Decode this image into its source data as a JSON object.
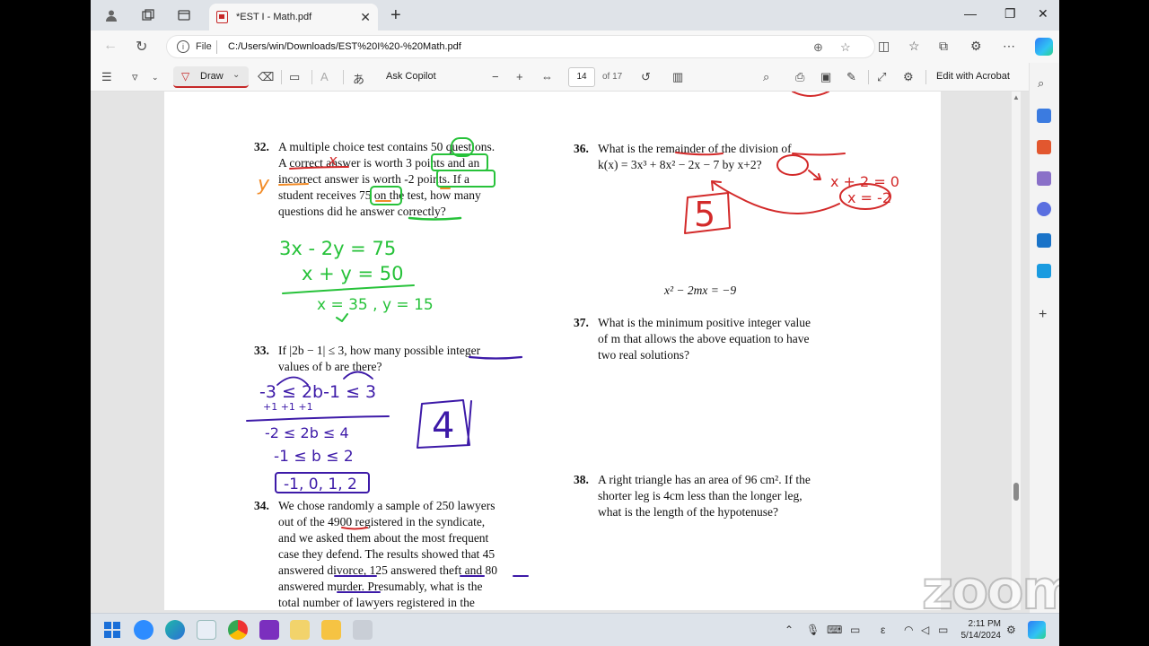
{
  "browser": {
    "tab_title": "*EST I - Math.pdf",
    "url_prefix": "File",
    "url": "C:/Users/win/Downloads/EST%20I%20-%20Math.pdf"
  },
  "pdf_toolbar": {
    "draw_label": "Draw",
    "ask_copilot": "Ask Copilot",
    "page_number": "14",
    "page_total": "of 17",
    "edit_acrobat": "Edit with Acrobat"
  },
  "questions": {
    "q32": {
      "number": "32.",
      "lines": [
        "A multiple choice test contains 50 questions.",
        "A correct answer is worth 3 points and an",
        "incorrect answer is worth -2 points. If a",
        "student receives 75 on the test, how many",
        "questions did he answer correctly?"
      ]
    },
    "q33": {
      "number": "33.",
      "lines": [
        "If |2b − 1| ≤ 3, how many possible integer",
        "values of b are there?"
      ]
    },
    "q34": {
      "number": "34.",
      "lines": [
        "We chose randomly a sample of 250 lawyers",
        "out of the 4900 registered in the syndicate,",
        "and we asked them about the most frequent",
        "case they defend. The results showed that 45",
        "answered divorce, 125 answered theft and 80",
        "answered murder. Presumably, what is the",
        "total number of lawyers registered in the"
      ]
    },
    "q36": {
      "number": "36.",
      "lines": [
        "What is the remainder of the division of",
        "k(x) = 3x³ + 8x² − 2x − 7 by x+2?"
      ]
    },
    "q37_equation": "x² − 2mx = −9",
    "q37": {
      "number": "37.",
      "lines": [
        "What is the minimum positive integer value",
        "of m that allows the above equation to have",
        "two real solutions?"
      ]
    },
    "q38": {
      "number": "38.",
      "lines": [
        "A right triangle has an area of 96 cm². If the",
        "shorter leg is 4cm less than the longer leg,",
        "what is the length of the hypotenuse?"
      ]
    }
  },
  "handwriting": {
    "q32_eq1": "3x - 2y = 75",
    "q32_eq2": "x + y = 50",
    "q32_answer": "x = 35 , y = 15",
    "q32_x": "x",
    "q32_y": "y",
    "q33_ineq1": "-3 ≤ 2b-1 ≤ 3",
    "q33_add": "+1          +1   +1",
    "q33_ineq2": "-2 ≤ 2b ≤ 4",
    "q33_ineq3": "-1 ≤ b ≤ 2",
    "q33_values": "-1, 0, 1, 2",
    "q33_answer": "4",
    "q36_step1": "x + 2 = 0",
    "q36_step2": "x = -2",
    "q36_answer": "5"
  },
  "taskbar": {
    "time": "2:11 PM",
    "date": "5/14/2024"
  },
  "watermark": "zoom",
  "colors": {
    "ink_green": "#27c23a",
    "ink_red": "#d32a2a",
    "ink_purple": "#3d1aa8",
    "ink_orange": "#f28c28"
  }
}
